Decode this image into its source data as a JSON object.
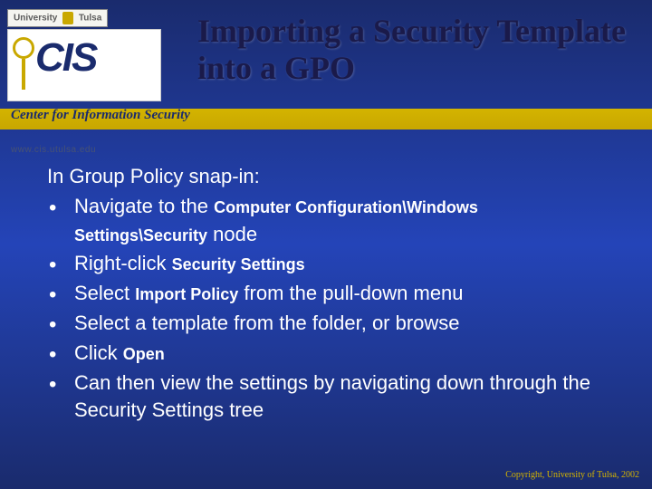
{
  "logo": {
    "uni_left": "University",
    "uni_right": "Tulsa",
    "cis": "CIS",
    "center": "Center for Information Security",
    "url": "www.cis.utulsa.edu"
  },
  "title": "Importing a Security Template into a GPO",
  "content": {
    "intro": "In Group Policy snap-in:",
    "bullets": [
      {
        "pre": "Navigate to the ",
        "mono": "Computer Configuration\\Windows Settings\\Security",
        "post": " node"
      },
      {
        "pre": "Right-click ",
        "mono": "Security Settings",
        "post": ""
      },
      {
        "pre": "Select ",
        "mono": "Import Policy",
        "post": " from the pull-down menu"
      },
      {
        "pre": "Select a template from the folder, or browse",
        "mono": "",
        "post": ""
      },
      {
        "pre": "Click ",
        "mono": "Open",
        "post": ""
      },
      {
        "pre": "Can then view the settings by navigating down through the Security Settings tree",
        "mono": "",
        "post": ""
      }
    ]
  },
  "copyright": "Copyright, University of Tulsa, 2002"
}
